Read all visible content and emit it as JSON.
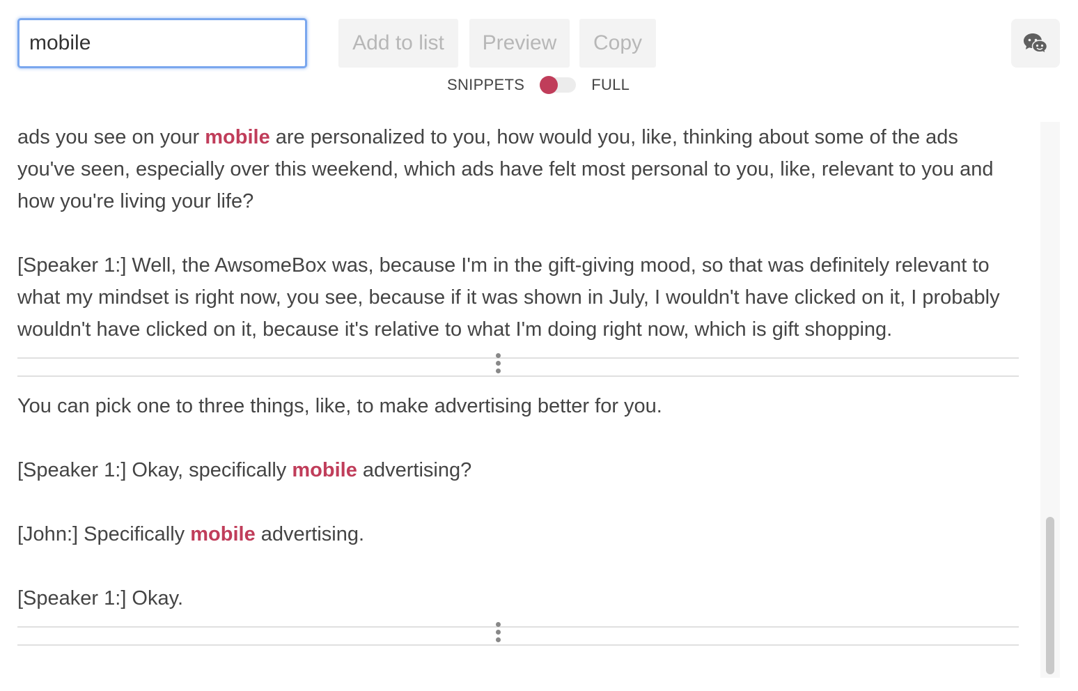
{
  "search": {
    "value": "mobile"
  },
  "toolbar": {
    "add_to_list_label": "Add to list",
    "preview_label": "Preview",
    "copy_label": "Copy",
    "icon_button": "chat-bubbles-icon"
  },
  "toggle": {
    "left_label": "SNIPPETS",
    "right_label": "FULL",
    "selected": "SNIPPETS"
  },
  "colors": {
    "highlight": "#c03d5a",
    "focus_ring": "#7aa7ee",
    "button_bg": "#f3f3f3",
    "button_text": "#b7b7b7"
  },
  "snippets": [
    {
      "paragraphs": [
        {
          "parts": [
            {
              "text": "ads you see on your ",
              "hl": false
            },
            {
              "text": "mobile",
              "hl": true
            },
            {
              "text": " are personalized to you, how would you, like, thinking about some of the ads you've seen, especially over this weekend, which ads have felt most personal to you, like, relevant to you and how you're living your life?",
              "hl": false
            }
          ]
        },
        {
          "parts": [
            {
              "text": "[Speaker 1:] Well, the AwsomeBox was, because I'm in the gift-giving mood, so that was definitely relevant to what my mindset is right now, you see, because if it was shown in July, I wouldn't have clicked on it, I probably wouldn't have clicked on it, because it's relative to what I'm doing right now, which is gift shopping.",
              "hl": false
            }
          ]
        }
      ]
    },
    {
      "paragraphs": [
        {
          "parts": [
            {
              "text": "You can pick one to three things, like, to make advertising better for you.",
              "hl": false
            }
          ]
        },
        {
          "parts": [
            {
              "text": "[Speaker 1:] Okay, specifically ",
              "hl": false
            },
            {
              "text": "mobile",
              "hl": true
            },
            {
              "text": " advertising?",
              "hl": false
            }
          ]
        },
        {
          "parts": [
            {
              "text": "[John:] Specifically ",
              "hl": false
            },
            {
              "text": "mobile",
              "hl": true
            },
            {
              "text": " advertising.",
              "hl": false
            }
          ]
        },
        {
          "parts": [
            {
              "text": "[Speaker 1:] Okay.",
              "hl": false
            }
          ]
        }
      ]
    }
  ]
}
